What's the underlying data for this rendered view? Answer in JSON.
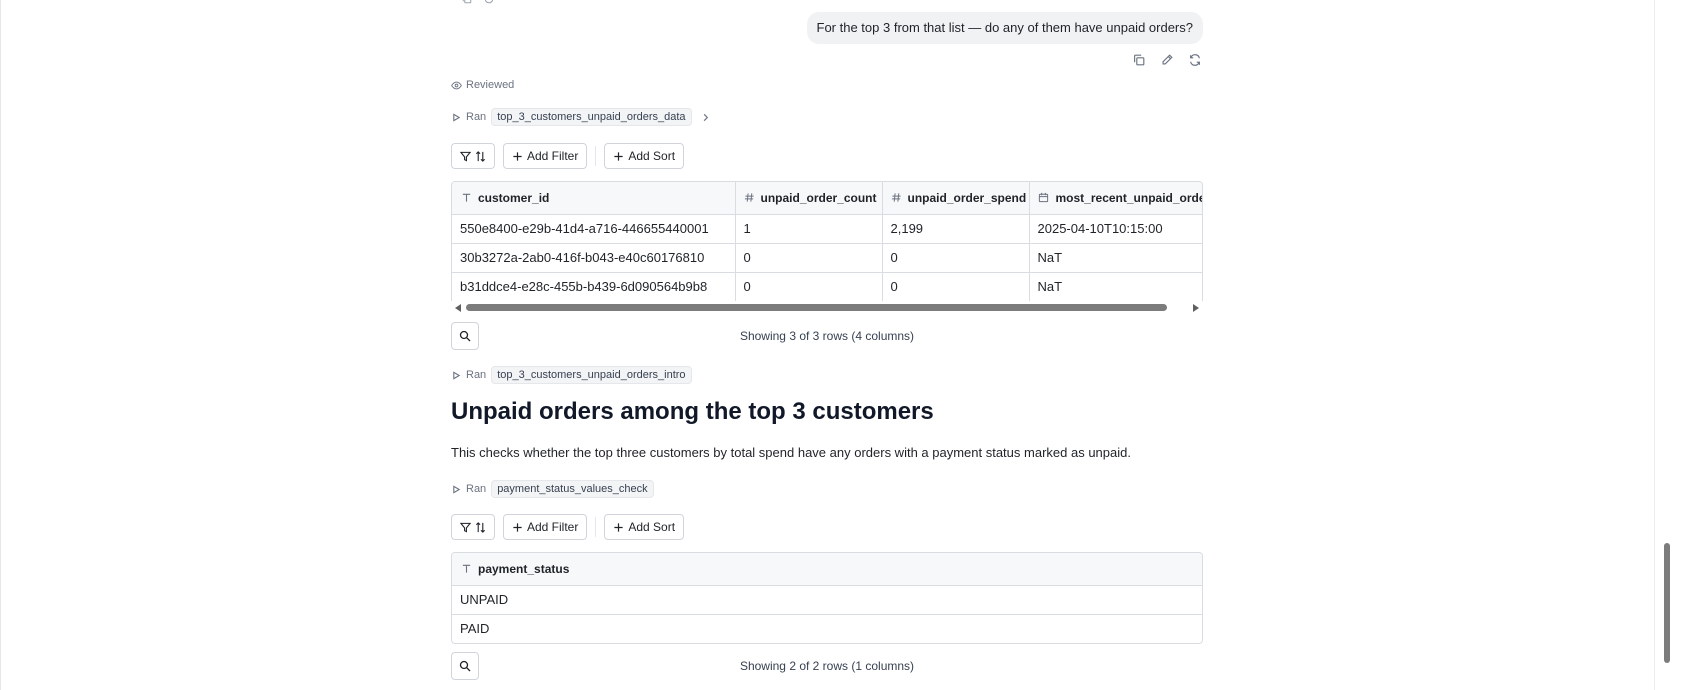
{
  "chat": {
    "user_message": "For the top 3 from that list — do any of them have unpaid orders?",
    "actions": [
      {
        "icon": "copy-icon"
      },
      {
        "icon": "edit-icon"
      },
      {
        "icon": "regenerate-icon"
      }
    ]
  },
  "reviewed": {
    "label": "Reviewed",
    "icon": "eye-icon"
  },
  "ran_label": "Ran",
  "cell1": {
    "chip": "top_3_customers_unpaid_orders_data",
    "toolbar": {
      "add_filter": "Add Filter",
      "add_sort": "Add Sort"
    },
    "columns": [
      {
        "name": "customer_id",
        "type_icon": "text-type-icon"
      },
      {
        "name": "unpaid_order_count",
        "type_icon": "number-type-icon"
      },
      {
        "name": "unpaid_order_spend",
        "type_icon": "number-type-icon"
      },
      {
        "name": "most_recent_unpaid_order_",
        "type_icon": "date-type-icon"
      }
    ],
    "rows": [
      [
        "550e8400-e29b-41d4-a716-446655440001",
        "1",
        "2,199",
        "2025-04-10T10:15:00"
      ],
      [
        "30b3272a-2ab0-416f-b043-e40c60176810",
        "0",
        "0",
        "NaT"
      ],
      [
        "b31ddce4-e28c-455b-b439-6d090564b9b8",
        "0",
        "0",
        "NaT"
      ]
    ],
    "row_count": "Showing 3 of 3 rows (4 columns)"
  },
  "cell2": {
    "chip": "top_3_customers_unpaid_orders_intro",
    "title": "Unpaid orders among the top 3 customers",
    "description": "This checks whether the top three customers by total spend have any orders with a payment status marked as unpaid."
  },
  "cell3": {
    "chip": "payment_status_values_check",
    "toolbar": {
      "add_filter": "Add Filter",
      "add_sort": "Add Sort"
    },
    "columns": [
      {
        "name": "payment_status",
        "type_icon": "text-type-icon"
      }
    ],
    "rows": [
      [
        "UNPAID"
      ],
      [
        "PAID"
      ]
    ],
    "row_count": "Showing 2 of 2 rows (1 columns)"
  }
}
